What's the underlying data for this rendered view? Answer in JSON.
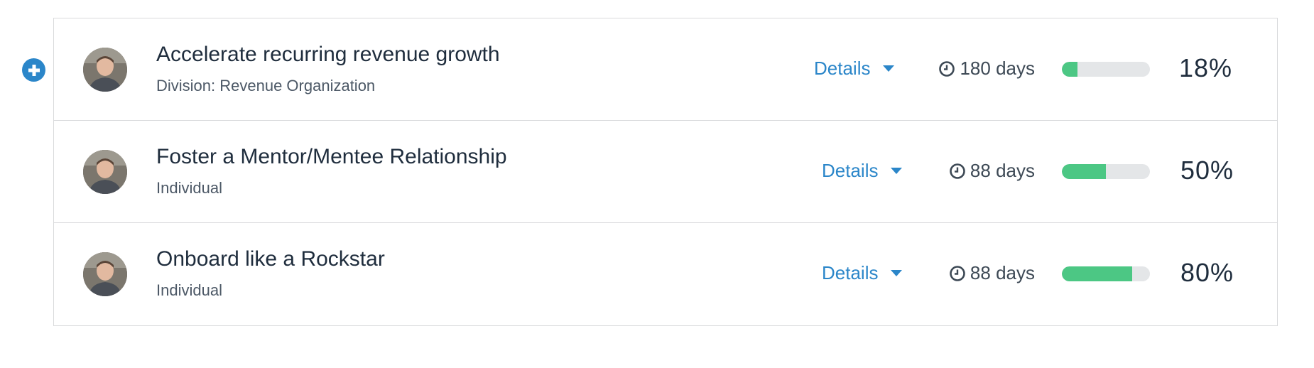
{
  "details_label": "Details",
  "goals": [
    {
      "title": "Accelerate recurring revenue growth",
      "subtitle": "Division: Revenue Organization",
      "due": "180 days",
      "progress": 0.18,
      "percent_label": "18%"
    },
    {
      "title": "Foster a Mentor/Mentee Relationship",
      "subtitle": "Individual",
      "due": "88 days",
      "progress": 0.5,
      "percent_label": "50%"
    },
    {
      "title": "Onboard like a Rockstar",
      "subtitle": "Individual",
      "due": "88 days",
      "progress": 0.8,
      "percent_label": "80%"
    }
  ],
  "icons": {
    "add": "plus-circle-icon",
    "due": "clock-icon",
    "details": "caret-down-icon"
  },
  "colors": {
    "accent": "#2b86c9",
    "progress_fill": "#4cc784",
    "progress_track": "#e4e6e8",
    "text_primary": "#1f2d3d"
  }
}
